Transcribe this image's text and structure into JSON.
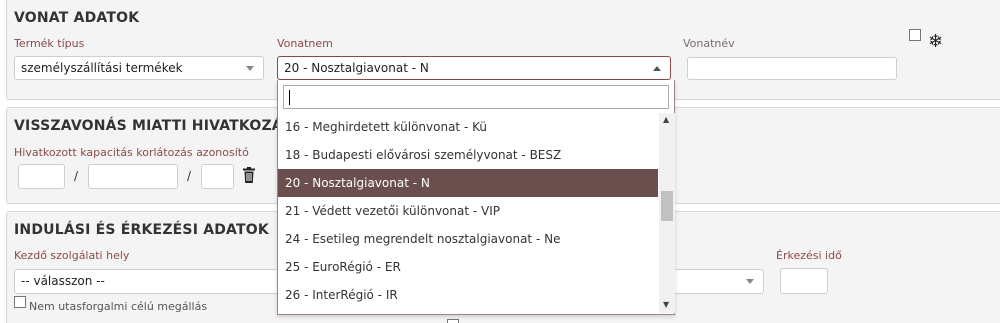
{
  "sections": {
    "vonat": {
      "title": "VONAT ADATOK",
      "termek_label": "Termék típus",
      "termek_value": "személyszállítási termékek",
      "vonatnem_label": "Vonatnem",
      "vonatnem_value": "20 - Nosztalgiavonat - N",
      "vonatnev_label": "Vonatnév",
      "vonatnev_value": "",
      "snow_icon": "❄"
    },
    "visszavonas": {
      "title": "VISSZAVONÁS MIATTI HIVATKOZÁSI AD",
      "kapacitas_label": "Hivatkozott kapacitás korlátozás azonosító",
      "slash1": "/",
      "slash2": "/"
    },
    "indulas": {
      "title": "INDULÁSI ÉS ÉRKEZÉSI ADATOK",
      "kezdo_label": "Kezdő szolgálati hely",
      "kezdo_value": "-- válasszon --",
      "erkezesi_label": "Érkezési idő",
      "nem_utas_label": "Nem utasforgalmi célú megállás"
    }
  },
  "dropdown": {
    "search_value": "",
    "items": [
      {
        "label": "16 - Meghirdetett különvonat - Kü",
        "selected": false
      },
      {
        "label": "18 - Budapesti elővárosi személyvonat - BESZ",
        "selected": false
      },
      {
        "label": "20 - Nosztalgiavonat - N",
        "selected": true
      },
      {
        "label": "21 - Védett vezetői különvonat - VIP",
        "selected": false
      },
      {
        "label": "24 - Esetileg megrendelt nosztalgiavonat - Ne",
        "selected": false
      },
      {
        "label": "25 - EuroRégió - ER",
        "selected": false
      },
      {
        "label": "26 - InterRégió - IR",
        "selected": false
      }
    ]
  },
  "colors": {
    "label": "#8b4a4a",
    "selected_bg": "#6b4f4f",
    "panel_bg": "#f4f4f4"
  }
}
